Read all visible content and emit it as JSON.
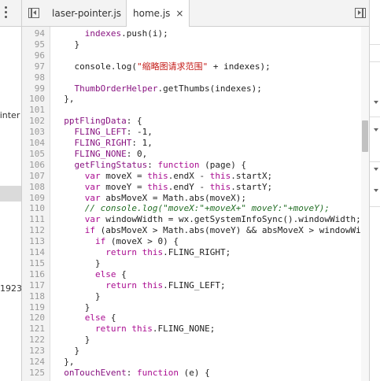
{
  "left_panel": {
    "texts": [
      {
        "text": "pointer",
        "name": "left-text-pointer"
      },
      {
        "text": "1923",
        "name": "left-text-1923"
      }
    ]
  },
  "tabs": [
    {
      "label": "laser-pointer.js",
      "active": false
    },
    {
      "label": "home.js",
      "active": true,
      "close": "×"
    }
  ],
  "editor": {
    "scroll_fraction": 0.29,
    "lines": [
      {
        "n": "94",
        "tokens": [
          [
            "nm",
            "      "
          ],
          [
            "id",
            "indexes"
          ],
          [
            "nm",
            ".push(i);"
          ]
        ]
      },
      {
        "n": "95",
        "tokens": [
          [
            "nm",
            "    }"
          ]
        ]
      },
      {
        "n": "96",
        "tokens": []
      },
      {
        "n": "97",
        "tokens": [
          [
            "nm",
            "    console.log("
          ],
          [
            "str",
            "\"缩略图请求范围\""
          ],
          [
            "nm",
            " + indexes);"
          ]
        ]
      },
      {
        "n": "98",
        "tokens": []
      },
      {
        "n": "99",
        "tokens": [
          [
            "id",
            "    ThumbOrderHelper"
          ],
          [
            "nm",
            ".getThumbs(indexes);"
          ]
        ]
      },
      {
        "n": "100",
        "tokens": [
          [
            "nm",
            "  },"
          ]
        ]
      },
      {
        "n": "101",
        "tokens": []
      },
      {
        "n": "102",
        "tokens": [
          [
            "id",
            "  pptFlingData"
          ],
          [
            "nm",
            ": {"
          ]
        ]
      },
      {
        "n": "103",
        "tokens": [
          [
            "id",
            "    FLING_LEFT"
          ],
          [
            "nm",
            ": -1,"
          ]
        ]
      },
      {
        "n": "104",
        "tokens": [
          [
            "id",
            "    FLING_RIGHT"
          ],
          [
            "nm",
            ": 1,"
          ]
        ]
      },
      {
        "n": "105",
        "tokens": [
          [
            "id",
            "    FLING_NONE"
          ],
          [
            "nm",
            ": 0,"
          ]
        ]
      },
      {
        "n": "106",
        "tokens": [
          [
            "id",
            "    getFlingStatus"
          ],
          [
            "nm",
            ": "
          ],
          [
            "kw",
            "function"
          ],
          [
            "nm",
            " (page) {"
          ]
        ]
      },
      {
        "n": "107",
        "tokens": [
          [
            "kw",
            "      var"
          ],
          [
            "nm",
            " moveX = "
          ],
          [
            "kw",
            "this"
          ],
          [
            "nm",
            ".endX - "
          ],
          [
            "kw",
            "this"
          ],
          [
            "nm",
            ".startX;"
          ]
        ]
      },
      {
        "n": "108",
        "tokens": [
          [
            "kw",
            "      var"
          ],
          [
            "nm",
            " moveY = "
          ],
          [
            "kw",
            "this"
          ],
          [
            "nm",
            ".endY - "
          ],
          [
            "kw",
            "this"
          ],
          [
            "nm",
            ".startY;"
          ]
        ]
      },
      {
        "n": "109",
        "tokens": [
          [
            "kw",
            "      var"
          ],
          [
            "nm",
            " absMoveX = Math.abs(moveX);"
          ]
        ]
      },
      {
        "n": "110",
        "tokens": [
          [
            "cm",
            "      // console.log(\"moveX:\"+moveX+\" moveY:\"+moveY);"
          ]
        ]
      },
      {
        "n": "111",
        "tokens": [
          [
            "kw",
            "      var"
          ],
          [
            "nm",
            " windowWidth = wx.getSystemInfoSync().windowWidth;"
          ]
        ]
      },
      {
        "n": "112",
        "tokens": [
          [
            "kw",
            "      if"
          ],
          [
            "nm",
            " (absMoveX > Math.abs(moveY) && absMoveX > windowWid"
          ]
        ]
      },
      {
        "n": "113",
        "tokens": [
          [
            "kw",
            "        if"
          ],
          [
            "nm",
            " (moveX > 0) {"
          ]
        ]
      },
      {
        "n": "114",
        "tokens": [
          [
            "kw",
            "          return"
          ],
          [
            "kw",
            " this"
          ],
          [
            "nm",
            ".FLING_RIGHT;"
          ]
        ]
      },
      {
        "n": "115",
        "tokens": [
          [
            "nm",
            "        }"
          ]
        ]
      },
      {
        "n": "116",
        "tokens": [
          [
            "kw",
            "        else"
          ],
          [
            "nm",
            " {"
          ]
        ]
      },
      {
        "n": "117",
        "tokens": [
          [
            "kw",
            "          return"
          ],
          [
            "kw",
            " this"
          ],
          [
            "nm",
            ".FLING_LEFT;"
          ]
        ]
      },
      {
        "n": "118",
        "tokens": [
          [
            "nm",
            "        }"
          ]
        ]
      },
      {
        "n": "119",
        "tokens": [
          [
            "nm",
            "      }"
          ]
        ]
      },
      {
        "n": "120",
        "tokens": [
          [
            "kw",
            "      else"
          ],
          [
            "nm",
            " {"
          ]
        ]
      },
      {
        "n": "121",
        "tokens": [
          [
            "kw",
            "        return"
          ],
          [
            "kw",
            " this"
          ],
          [
            "nm",
            ".FLING_NONE;"
          ]
        ]
      },
      {
        "n": "122",
        "tokens": [
          [
            "nm",
            "      }"
          ]
        ]
      },
      {
        "n": "123",
        "tokens": [
          [
            "nm",
            "    }"
          ]
        ]
      },
      {
        "n": "124",
        "tokens": [
          [
            "nm",
            "  },"
          ]
        ]
      },
      {
        "n": "125",
        "tokens": [
          [
            "id",
            "  onTouchEvent"
          ],
          [
            "nm",
            ": "
          ],
          [
            "kw",
            "function"
          ],
          [
            "nm",
            " (e) {"
          ]
        ]
      }
    ]
  }
}
